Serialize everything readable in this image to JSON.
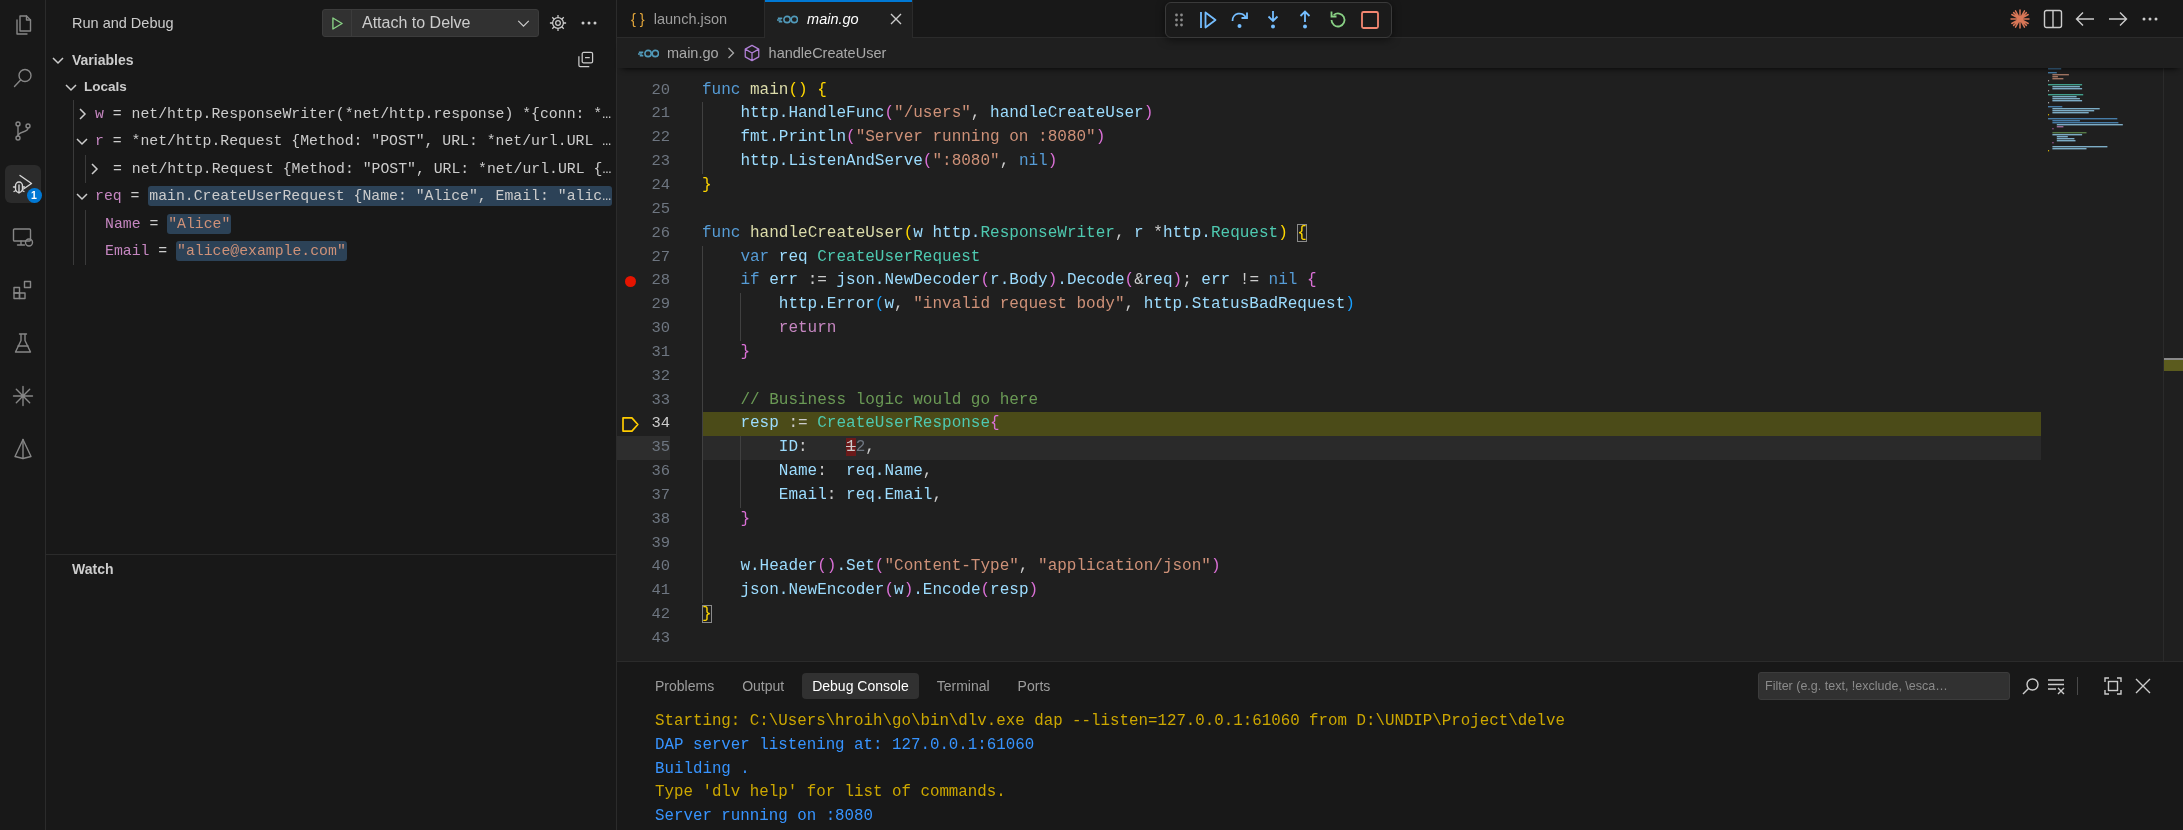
{
  "activity_bar": [
    {
      "kind": "files",
      "selected": false
    },
    {
      "kind": "search",
      "selected": false
    },
    {
      "kind": "branch",
      "selected": false
    },
    {
      "kind": "debug",
      "selected": true,
      "badge": "1"
    },
    {
      "kind": "remote",
      "selected": false
    },
    {
      "kind": "extensions",
      "selected": false
    },
    {
      "kind": "flask",
      "selected": false
    },
    {
      "kind": "spark",
      "selected": false
    },
    {
      "kind": "sail",
      "selected": false
    }
  ],
  "sidebar": {
    "title": "Run and Debug",
    "launch_config": "Attach to Delve",
    "variables": {
      "title": "Variables",
      "expanded": true,
      "scopes": [
        {
          "name": "Locals",
          "expanded": true,
          "items": [
            {
              "name": "w",
              "operator": "=",
              "value": "net/http.ResponseWriter(*net/http.response) *{conn: *…",
              "kind": "object",
              "expanded": false,
              "changed": false
            },
            {
              "name": "r",
              "operator": "=",
              "value": "*net/http.Request {Method: \"POST\", URL: *net/url.URL …",
              "kind": "object",
              "expanded": true,
              "changed": false,
              "children": [
                {
                  "operator": "=",
                  "value": "net/http.Request {Method: \"POST\", URL: *net/url.URL {…",
                  "kind": "object",
                  "expanded": false,
                  "changed": false
                }
              ]
            },
            {
              "name": "req",
              "operator": "=",
              "value": "main.CreateUserRequest {Name: \"Alice\", Email: \"alic…",
              "kind": "object",
              "expanded": true,
              "changed": true,
              "children": [
                {
                  "name": "Name",
                  "operator": "=",
                  "value": "\"Alice\"",
                  "kind": "string",
                  "changed": true
                },
                {
                  "name": "Email",
                  "operator": "=",
                  "value": "\"alice@example.com\"",
                  "kind": "string",
                  "changed": true
                }
              ]
            }
          ]
        }
      ]
    },
    "watch": {
      "title": "Watch"
    }
  },
  "editor": {
    "tabs": [
      {
        "kind": "json",
        "glyph": "{ }",
        "label": "launch.json",
        "selected": false,
        "preview": false
      },
      {
        "kind": "go",
        "label": "main.go",
        "selected": true,
        "preview": true
      }
    ],
    "breadcrumbs": [
      {
        "kind": "file",
        "label": "main.go"
      },
      {
        "kind": "symbol",
        "label": "handleCreateUser"
      }
    ],
    "lines": [
      {
        "number": "20",
        "breakpoint": false,
        "paused": false,
        "cursor": false,
        "tokens": [
          {
            "text": "func ",
            "kind": "kw"
          },
          {
            "text": "main",
            "kind": "fn"
          },
          {
            "text": "() {",
            "kind": "b1"
          }
        ]
      },
      {
        "number": "21",
        "breakpoint": false,
        "paused": false,
        "cursor": false,
        "tokens": [
          {
            "text": "    http.HandleFunc",
            "kind": "var"
          },
          {
            "text": "(",
            "kind": "b2"
          },
          {
            "text": "\"/users\"",
            "kind": "str"
          },
          {
            "text": ", ",
            "kind": "plain"
          },
          {
            "text": "handleCreateUser",
            "kind": "var"
          },
          {
            "text": ")",
            "kind": "b2"
          }
        ]
      },
      {
        "number": "22",
        "breakpoint": false,
        "paused": false,
        "cursor": false,
        "tokens": [
          {
            "text": "    fmt.Println",
            "kind": "var"
          },
          {
            "text": "(",
            "kind": "b2"
          },
          {
            "text": "\"Server running on :8080\"",
            "kind": "str"
          },
          {
            "text": ")",
            "kind": "b2"
          }
        ]
      },
      {
        "number": "23",
        "breakpoint": false,
        "paused": false,
        "cursor": false,
        "tokens": [
          {
            "text": "    http.ListenAndServe",
            "kind": "var"
          },
          {
            "text": "(",
            "kind": "b2"
          },
          {
            "text": "\":8080\"",
            "kind": "str"
          },
          {
            "text": ", ",
            "kind": "plain"
          },
          {
            "text": "nil",
            "kind": "kw"
          },
          {
            "text": ")",
            "kind": "b2"
          }
        ]
      },
      {
        "number": "24",
        "breakpoint": false,
        "paused": false,
        "cursor": false,
        "tokens": [
          {
            "text": "}",
            "kind": "b1"
          }
        ]
      },
      {
        "number": "25",
        "breakpoint": false,
        "paused": false,
        "cursor": false
      },
      {
        "number": "26",
        "breakpoint": false,
        "paused": false,
        "cursor": false,
        "tokens": [
          {
            "text": "func ",
            "kind": "kw"
          },
          {
            "text": "handleCreateUser",
            "kind": "fn"
          },
          {
            "text": "(",
            "kind": "b1"
          },
          {
            "text": "w http.",
            "kind": "var"
          },
          {
            "text": "ResponseWriter",
            "kind": "type"
          },
          {
            "text": ", ",
            "kind": "plain"
          },
          {
            "text": "r ",
            "kind": "var"
          },
          {
            "text": "*",
            "kind": "plain"
          },
          {
            "text": "http.",
            "kind": "var"
          },
          {
            "text": "Request",
            "kind": "type"
          },
          {
            "text": ") ",
            "kind": "b1"
          },
          {
            "text": "{",
            "kind": "bracematch"
          }
        ]
      },
      {
        "number": "27",
        "breakpoint": false,
        "paused": false,
        "cursor": false,
        "tokens": [
          {
            "text": "    var ",
            "kind": "kw"
          },
          {
            "text": "req ",
            "kind": "var"
          },
          {
            "text": "CreateUserRequest",
            "kind": "type"
          }
        ]
      },
      {
        "number": "28",
        "breakpoint": true,
        "paused": false,
        "cursor": false,
        "tokens": [
          {
            "text": "    if ",
            "kind": "kw"
          },
          {
            "text": "err",
            "kind": "var"
          },
          {
            "text": " := ",
            "kind": "plain"
          },
          {
            "text": "json.NewDecoder",
            "kind": "var"
          },
          {
            "text": "(",
            "kind": "b2"
          },
          {
            "text": "r.Body",
            "kind": "var"
          },
          {
            "text": ")",
            "kind": "b2"
          },
          {
            "text": ".Decode",
            "kind": "var"
          },
          {
            "text": "(",
            "kind": "b2"
          },
          {
            "text": "&",
            "kind": "plain"
          },
          {
            "text": "req",
            "kind": "var"
          },
          {
            "text": ")",
            "kind": "b2"
          },
          {
            "text": "; ",
            "kind": "plain"
          },
          {
            "text": "err",
            "kind": "var"
          },
          {
            "text": " != ",
            "kind": "plain"
          },
          {
            "text": "nil ",
            "kind": "kw"
          },
          {
            "text": "{",
            "kind": "b2"
          }
        ]
      },
      {
        "number": "29",
        "breakpoint": false,
        "paused": false,
        "cursor": false,
        "tokens": [
          {
            "text": "        http.Error",
            "kind": "var"
          },
          {
            "text": "(",
            "kind": "b3"
          },
          {
            "text": "w",
            "kind": "var"
          },
          {
            "text": ", ",
            "kind": "plain"
          },
          {
            "text": "\"invalid request body\"",
            "kind": "str"
          },
          {
            "text": ", ",
            "kind": "plain"
          },
          {
            "text": "http.StatusBadRequest",
            "kind": "var"
          },
          {
            "text": ")",
            "kind": "b3"
          }
        ]
      },
      {
        "number": "30",
        "breakpoint": false,
        "paused": false,
        "cursor": false,
        "tokens": [
          {
            "text": "        return",
            "kind": "ctl"
          }
        ]
      },
      {
        "number": "31",
        "breakpoint": false,
        "paused": false,
        "cursor": false,
        "tokens": [
          {
            "text": "    }",
            "kind": "b2"
          }
        ]
      },
      {
        "number": "32",
        "breakpoint": false,
        "paused": false,
        "cursor": false
      },
      {
        "number": "33",
        "breakpoint": false,
        "paused": false,
        "cursor": false,
        "tokens": [
          {
            "text": "    // Business logic would go here",
            "kind": "com"
          }
        ]
      },
      {
        "number": "34",
        "breakpoint": false,
        "paused": true,
        "cursor": false,
        "tokens": [
          {
            "text": "    resp",
            "kind": "var"
          },
          {
            "text": " := ",
            "kind": "plain"
          },
          {
            "text": "CreateUserResponse",
            "kind": "type"
          },
          {
            "text": "{",
            "kind": "b2"
          }
        ]
      },
      {
        "number": "35",
        "breakpoint": false,
        "paused": false,
        "cursor": true,
        "tokens": [
          {
            "text": "        ID",
            "kind": "var"
          },
          {
            "text": ":    ",
            "kind": "plain"
          },
          {
            "text": "1",
            "kind": "deleted"
          },
          {
            "text": "2",
            "kind": "ghost"
          },
          {
            "text": ",",
            "kind": "plain"
          }
        ]
      },
      {
        "number": "36",
        "breakpoint": false,
        "paused": false,
        "cursor": false,
        "tokens": [
          {
            "text": "        Name",
            "kind": "var"
          },
          {
            "text": ":  ",
            "kind": "plain"
          },
          {
            "text": "req.Name",
            "kind": "var"
          },
          {
            "text": ",",
            "kind": "plain"
          }
        ]
      },
      {
        "number": "37",
        "breakpoint": false,
        "paused": false,
        "cursor": false,
        "tokens": [
          {
            "text": "        Email",
            "kind": "var"
          },
          {
            "text": ": ",
            "kind": "plain"
          },
          {
            "text": "req.Email",
            "kind": "var"
          },
          {
            "text": ",",
            "kind": "plain"
          }
        ]
      },
      {
        "number": "38",
        "breakpoint": false,
        "paused": false,
        "cursor": false,
        "tokens": [
          {
            "text": "    }",
            "kind": "b2"
          }
        ]
      },
      {
        "number": "39",
        "breakpoint": false,
        "paused": false,
        "cursor": false
      },
      {
        "number": "40",
        "breakpoint": false,
        "paused": false,
        "cursor": false,
        "tokens": [
          {
            "text": "    w.Header",
            "kind": "var"
          },
          {
            "text": "()",
            "kind": "b2"
          },
          {
            "text": ".Set",
            "kind": "var"
          },
          {
            "text": "(",
            "kind": "b2"
          },
          {
            "text": "\"Content-Type\"",
            "kind": "str"
          },
          {
            "text": ", ",
            "kind": "plain"
          },
          {
            "text": "\"application/json\"",
            "kind": "str"
          },
          {
            "text": ")",
            "kind": "b2"
          }
        ]
      },
      {
        "number": "41",
        "breakpoint": false,
        "paused": false,
        "cursor": false,
        "tokens": [
          {
            "text": "    json.NewEncoder",
            "kind": "var"
          },
          {
            "text": "(",
            "kind": "b2"
          },
          {
            "text": "w",
            "kind": "var"
          },
          {
            "text": ")",
            "kind": "b2"
          },
          {
            "text": ".Encode",
            "kind": "var"
          },
          {
            "text": "(",
            "kind": "b2"
          },
          {
            "text": "resp",
            "kind": "var"
          },
          {
            "text": ")",
            "kind": "b2"
          }
        ]
      },
      {
        "number": "42",
        "breakpoint": false,
        "paused": false,
        "cursor": false,
        "tokens": [
          {
            "text": "}",
            "kind": "bracematch"
          }
        ]
      },
      {
        "number": "43",
        "breakpoint": false,
        "paused": false,
        "cursor": false
      }
    ]
  },
  "panel": {
    "tabs": [
      {
        "label": "Problems",
        "selected": false
      },
      {
        "label": "Output",
        "selected": false
      },
      {
        "label": "Debug Console",
        "selected": true
      },
      {
        "label": "Terminal",
        "selected": false
      },
      {
        "label": "Ports",
        "selected": false
      }
    ],
    "filter": {
      "placeholder": "Filter (e.g. text, !exclude, \\esca…"
    },
    "console": [
      {
        "text": "Starting: C:\\Users\\hroih\\go\\bin\\dlv.exe dap --listen=127.0.0.1:61060 from D:\\UNDIP\\Project\\delve",
        "color": "#cca700"
      },
      {
        "text": "DAP server listening at: 127.0.0.1:61060",
        "color": "#3794ff"
      },
      {
        "text": "Building .",
        "color": "#3794ff"
      },
      {
        "text": "Type 'dlv help' for list of commands.",
        "color": "#cca700"
      },
      {
        "text": "Server running on :8080",
        "color": "#3794ff"
      }
    ]
  }
}
